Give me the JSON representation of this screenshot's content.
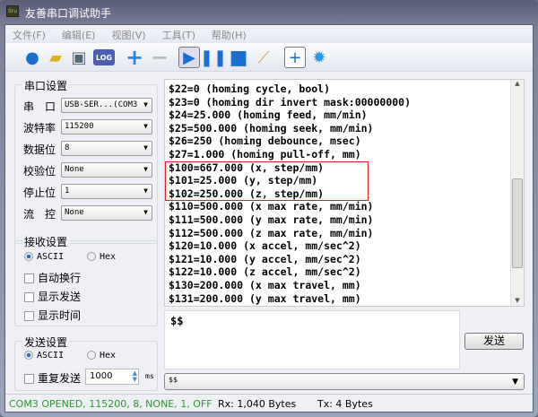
{
  "window": {
    "title": "友善串口调试助手",
    "icon_text": "Sru"
  },
  "menu": [
    "文件(F)",
    "编辑(E)",
    "视图(V)",
    "工具(T)",
    "帮助(H)"
  ],
  "toolbar": {
    "log_label": "LOG"
  },
  "serial": {
    "group": "串口设置",
    "rows": [
      {
        "label": "串　口",
        "value": "USB-SER...(COM3"
      },
      {
        "label": "波特率",
        "value": "115200"
      },
      {
        "label": "数据位",
        "value": "8"
      },
      {
        "label": "校验位",
        "value": "None"
      },
      {
        "label": "停止位",
        "value": "1"
      },
      {
        "label": "流　控",
        "value": "None"
      }
    ]
  },
  "receive": {
    "group": "接收设置",
    "ascii": "ASCII",
    "hex": "Hex",
    "auto_wrap": "自动换行",
    "show_send": "显示发送",
    "show_time": "显示时间"
  },
  "send_settings": {
    "group": "发送设置",
    "ascii": "ASCII",
    "hex": "Hex",
    "repeat": "重复发送",
    "interval": "1000",
    "unit": "ms"
  },
  "output_lines": [
    "$22=0 (homing cycle, bool)",
    "$23=0 (homing dir invert mask:00000000)",
    "$24=25.000 (homing feed, mm/min)",
    "$25=500.000 (homing seek, mm/min)",
    "$26=250 (homing debounce, msec)",
    "$27=1.000 (homing pull-off, mm)",
    "$100=667.000 (x, step/mm)",
    "$101=25.000 (y, step/mm)",
    "$102=250.000 (z, step/mm)",
    "$110=500.000 (x max rate, mm/min)",
    "$111=500.000 (y max rate, mm/min)",
    "$112=500.000 (z max rate, mm/min)",
    "$120=10.000 (x accel, mm/sec^2)",
    "$121=10.000 (y accel, mm/sec^2)",
    "$122=10.000 (z accel, mm/sec^2)",
    "$130=200.000 (x max travel, mm)",
    "$131=200.000 (y max travel, mm)"
  ],
  "send_input": "$$",
  "send_button": "发送",
  "history": "$$",
  "status": {
    "port": "COM3 OPENED, 115200, 8, NONE, 1, OFF",
    "rx": "Rx: 1,040 Bytes",
    "tx": "Tx: 4 Bytes"
  },
  "colors": {
    "status_ok": "#2a9a2a",
    "highlight": "#e02020"
  }
}
